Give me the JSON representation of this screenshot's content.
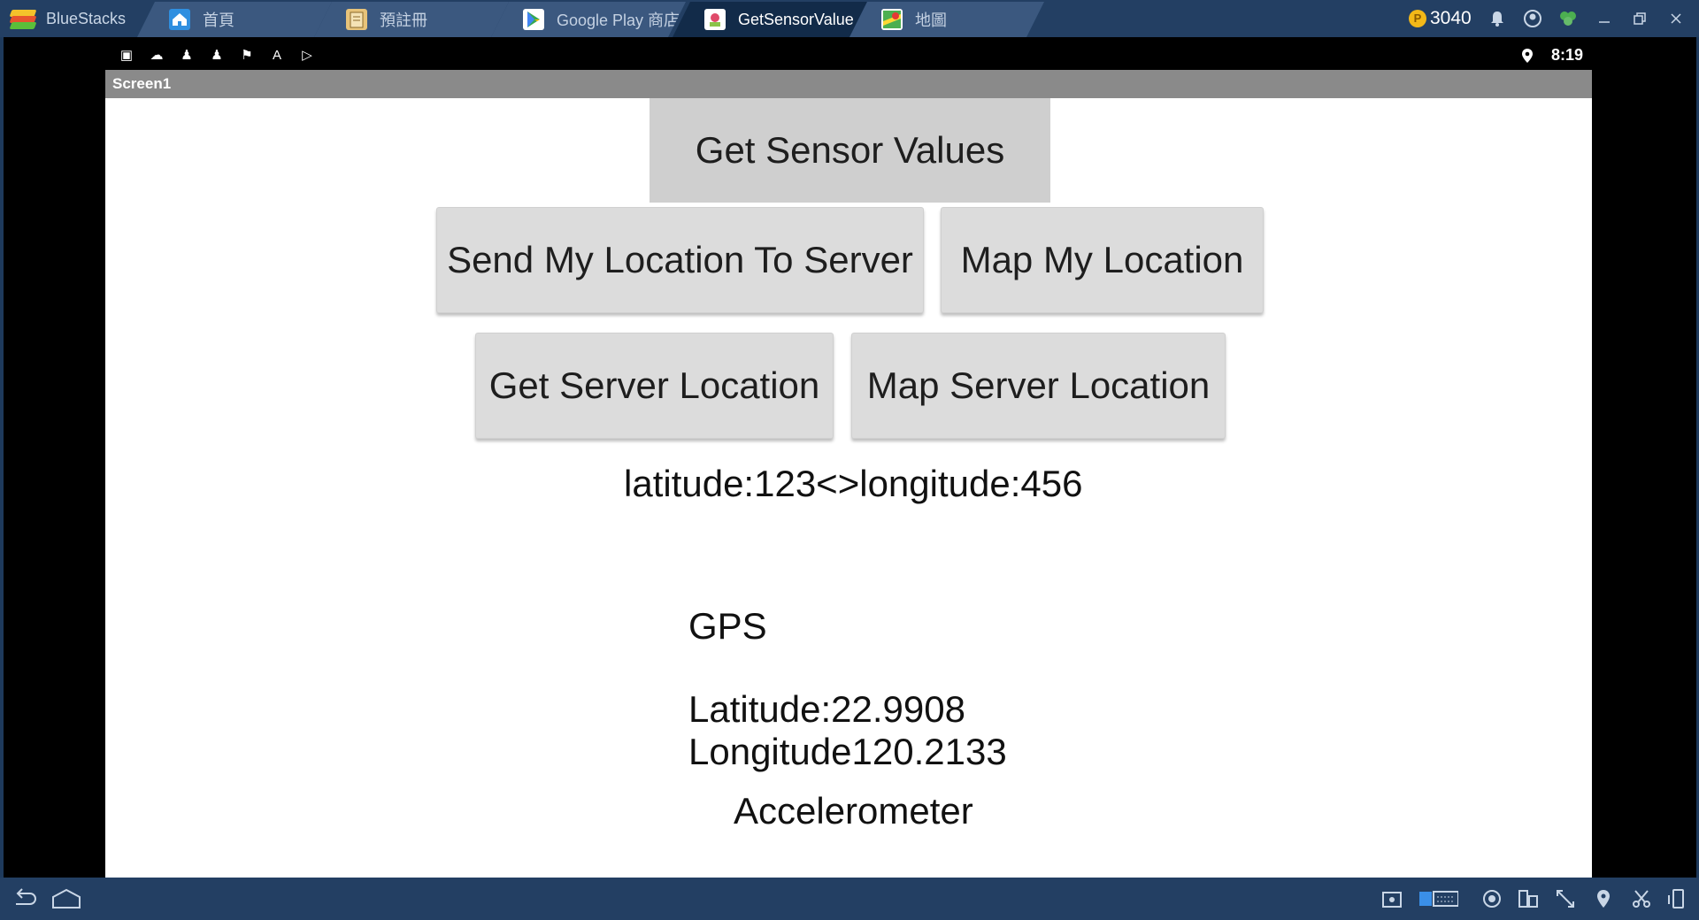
{
  "window": {
    "app_name": "BlueStacks",
    "coins": "3040",
    "tabs": [
      {
        "label": "首頁",
        "icon": "home-icon"
      },
      {
        "label": "預註冊",
        "icon": "notepad-icon"
      },
      {
        "label": "Google Play 商店",
        "icon": "play-store-icon"
      },
      {
        "label": "GetSensorValue",
        "icon": "app-icon"
      },
      {
        "label": "地圖",
        "icon": "maps-icon"
      }
    ],
    "active_tab": "GetSensorValue",
    "colors": {
      "titlebar": "#233f63",
      "tab": "#3b587f",
      "active_tab": "#122b49",
      "coin": "#f2b818"
    }
  },
  "android": {
    "time": "8:19",
    "screen_title": "Screen1"
  },
  "app": {
    "get_sensor_values": "Get Sensor Values",
    "send_location": "Send My Location To Server",
    "map_my_location": "Map My Location",
    "get_server_location": "Get Server Location",
    "map_server_location": "Map Server Location",
    "lat_long_text": "latitude:123<>longitude:456",
    "gps_label": "GPS",
    "latitude_text": "Latitude:22.9908",
    "longitude_text": "Longitude120.2133",
    "accelerometer_label": "Accelerometer"
  }
}
